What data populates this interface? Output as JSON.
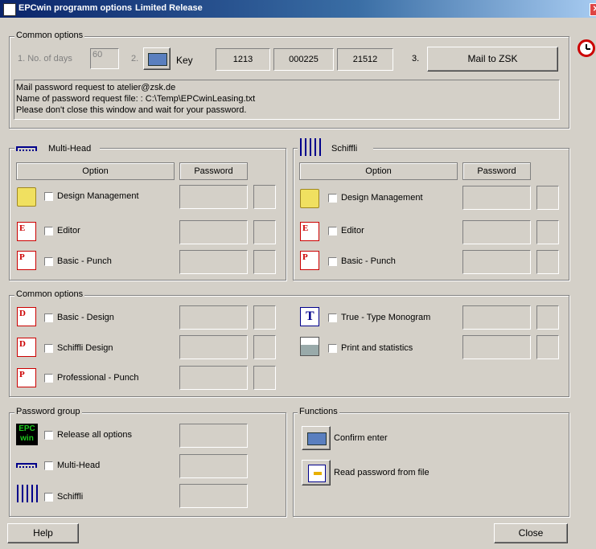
{
  "window": {
    "title": "EPCwin programm options",
    "subtitle": "Limited Release"
  },
  "common_top": {
    "label": "Common options",
    "no_of_days_label": "1. No. of days",
    "no_of_days_value": "60",
    "step2_label": "2.",
    "key_label": "Key",
    "keys": [
      "1213",
      "000225",
      "21512"
    ],
    "step3_label": "3.",
    "mail_button": "Mail to ZSK",
    "messages": [
      "Mail password request to atelier@zsk.de",
      "Name of password request file: : C:\\Temp\\EPCwinLeasing.txt",
      "Please don't close this window and wait for your password."
    ]
  },
  "multihead": {
    "label": "Multi-Head",
    "col_option": "Option",
    "col_password": "Password",
    "items": [
      "Design Management",
      "Editor",
      "Basic - Punch"
    ]
  },
  "schiffli": {
    "label": "Schiffli",
    "col_option": "Option",
    "col_password": "Password",
    "items": [
      "Design Management",
      "Editor",
      "Basic - Punch"
    ]
  },
  "common_options": {
    "label": "Common options",
    "left_items": [
      "Basic - Design",
      "Schiffli Design",
      "Professional - Punch"
    ],
    "right_items": [
      "True - Type Monogram",
      "Print and statistics"
    ]
  },
  "password_group": {
    "label": "Password group",
    "items": [
      "Release all options",
      "Multi-Head",
      "Schiffli"
    ],
    "epc_icon_text": [
      "EPC",
      "win"
    ]
  },
  "functions": {
    "label": "Functions",
    "confirm": "Confirm enter",
    "read": "Read password from file"
  },
  "footer": {
    "help": "Help",
    "close": "Close"
  },
  "icons": [
    "calculator-icon",
    "folder-icon",
    "editor-icon",
    "punch-icon",
    "design-icon",
    "monogram-icon",
    "printer-icon",
    "multihead-icon",
    "schiffli-icon",
    "clock-icon"
  ]
}
